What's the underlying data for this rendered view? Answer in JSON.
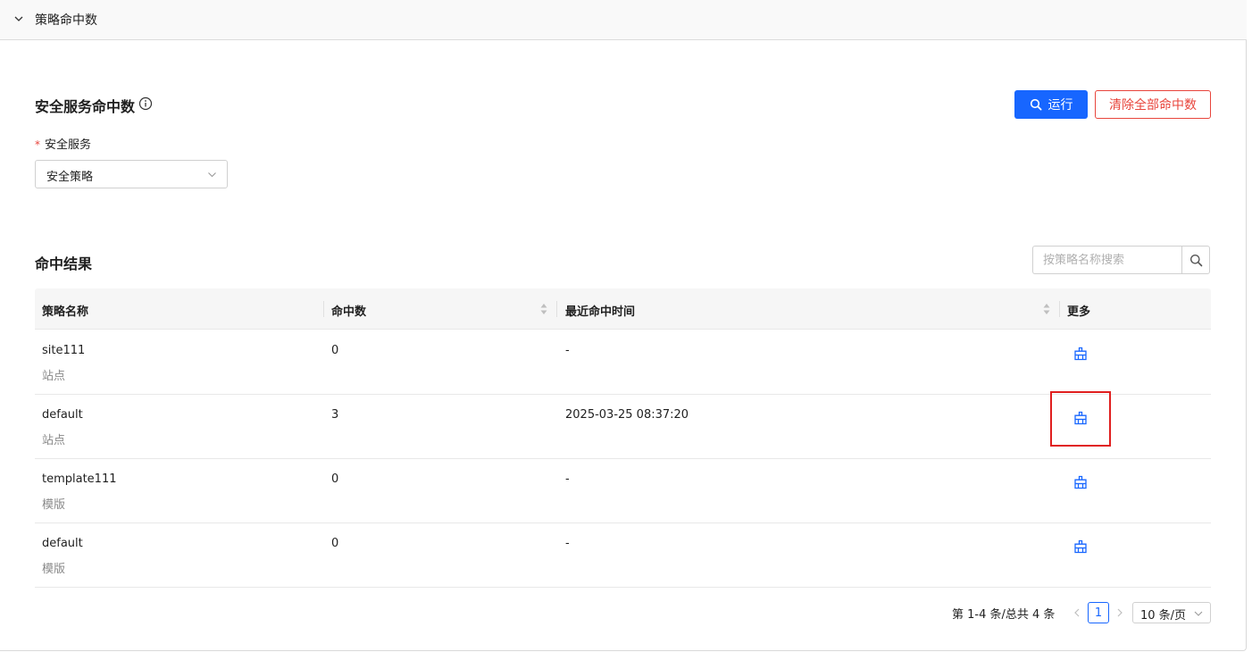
{
  "panel": {
    "title": "策略命中数",
    "collapse_icon": "chevron-down-icon"
  },
  "section": {
    "title": "安全服务命中数",
    "info_icon": "info-circle-icon"
  },
  "actions": {
    "run_label": "运行",
    "run_icon": "search-icon",
    "clear_all_label": "清除全部命中数"
  },
  "service_field": {
    "required_mark": "*",
    "label": "安全服务",
    "value": "安全策略"
  },
  "results": {
    "title": "命中结果",
    "search_placeholder": "按策略名称搜索",
    "columns": {
      "name": "策略名称",
      "hits": "命中数",
      "last_hit": "最近命中时间",
      "more": "更多"
    },
    "rows": [
      {
        "name": "site111",
        "type": "站点",
        "hits": "0",
        "last_hit": "-"
      },
      {
        "name": "default",
        "type": "站点",
        "hits": "3",
        "last_hit": "2025-03-25 08:37:20"
      },
      {
        "name": "template111",
        "type": "模版",
        "hits": "0",
        "last_hit": "-"
      },
      {
        "name": "default",
        "type": "模版",
        "hits": "0",
        "last_hit": "-"
      }
    ],
    "row_action_icon": "clear-hits-icon"
  },
  "pagination": {
    "total_text": "第 1-4 条/总共 4 条",
    "current_page": "1",
    "page_size": "10 条/页"
  },
  "colors": {
    "primary": "#1766ff",
    "danger": "#e8453c",
    "highlight": "#e01f1f"
  }
}
